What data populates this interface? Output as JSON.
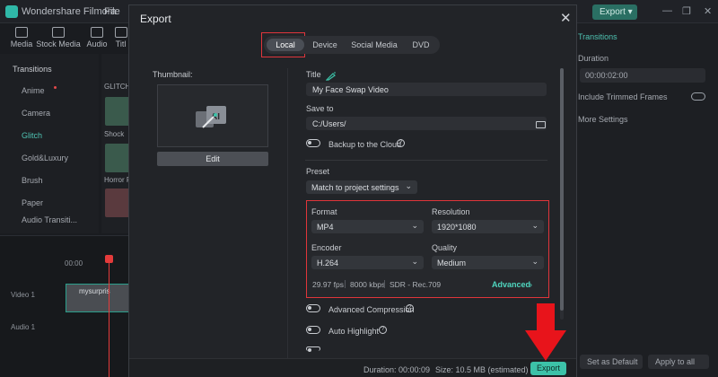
{
  "app": {
    "name": "Wondershare Filmora",
    "menu_file": "File",
    "top_export": "Export"
  },
  "toolbar": {
    "items": [
      "Media",
      "Stock Media",
      "Audio",
      "Titl"
    ]
  },
  "left_panel": {
    "section": "Transitions",
    "items": [
      "Anime",
      "Camera",
      "Glitch",
      "Gold&Luxury",
      "Brush",
      "Paper",
      "Audio Transiti..."
    ],
    "thumb_header": "GLITCH",
    "thumb_labels": [
      "Shock",
      "Horror R"
    ]
  },
  "timeline": {
    "time": "00:00",
    "video_track": "Video 1",
    "audio_track": "Audio 1",
    "clip_name": "mysurpris"
  },
  "right_panel": {
    "tab": "Transitions",
    "duration_label": "Duration",
    "duration_value": "00:00:02:00",
    "include_trimmed": "Include Trimmed Frames",
    "more_settings": "More Settings",
    "set_default": "Set as Default",
    "apply_all": "Apply to all"
  },
  "dialog": {
    "title": "Export",
    "tabs": [
      "Local",
      "Device",
      "Social Media",
      "DVD"
    ],
    "active_tab": "Local",
    "thumbnail_label": "Thumbnail:",
    "edit_button": "Edit",
    "title_label": "Title",
    "title_value": "My Face Swap Video",
    "save_to_label": "Save to",
    "save_to_value": "C:/Users/",
    "backup_label": "Backup to the Cloud",
    "preset_label": "Preset",
    "preset_value": "Match to project settings",
    "format_label": "Format",
    "format_value": "MP4",
    "resolution_label": "Resolution",
    "resolution_value": "1920*1080",
    "encoder_label": "Encoder",
    "encoder_value": "H.264",
    "quality_label": "Quality",
    "quality_value": "Medium",
    "fps": "29.97 fps",
    "bitrate": "8000 kbps",
    "color_space": "SDR - Rec.709",
    "advanced_link": "Advanced",
    "advanced_compression": "Advanced Compression",
    "auto_highlight": "Auto Highlight",
    "duration_text": "Duration: 00:00:09",
    "size_text": "Size:  10.5 MB (estimated)",
    "export_button": "Export"
  },
  "colors": {
    "accent": "#3cc2a8",
    "highlight_box": "#e0353b",
    "arrow": "#e8141b"
  }
}
